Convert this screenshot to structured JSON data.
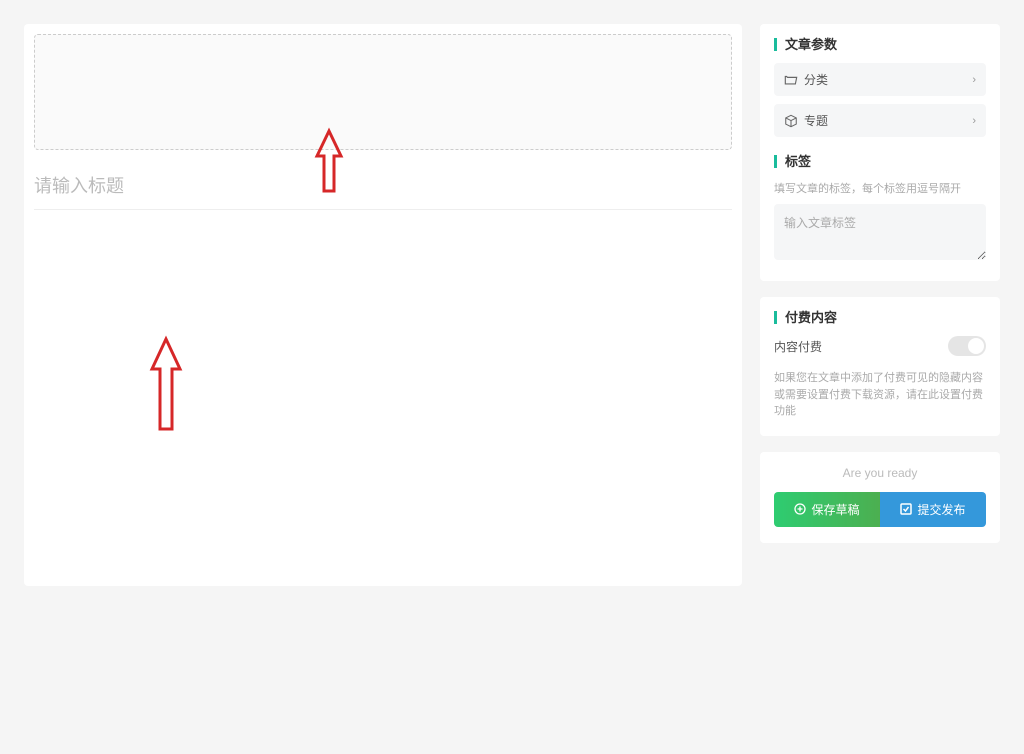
{
  "main": {
    "title_placeholder": "请输入标题"
  },
  "sidebar": {
    "params": {
      "title": "文章参数",
      "category": "分类",
      "topic": "专题"
    },
    "tags": {
      "title": "标签",
      "hint": "填写文章的标签，每个标签用逗号隔开",
      "placeholder": "输入文章标签"
    },
    "paid": {
      "title": "付费内容",
      "toggle_label": "内容付费",
      "hint": "如果您在文章中添加了付费可见的隐藏内容或需要设置付费下载资源，请在此设置付费功能"
    },
    "actions": {
      "ready": "Are you ready",
      "save": "保存草稿",
      "publish": "提交发布"
    }
  }
}
